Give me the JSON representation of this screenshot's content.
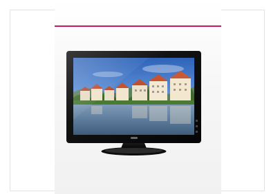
{
  "product": {
    "name_icon": "lcd-monitor-image",
    "accent_color": "#c8175d",
    "bezel_color": "#141414"
  }
}
